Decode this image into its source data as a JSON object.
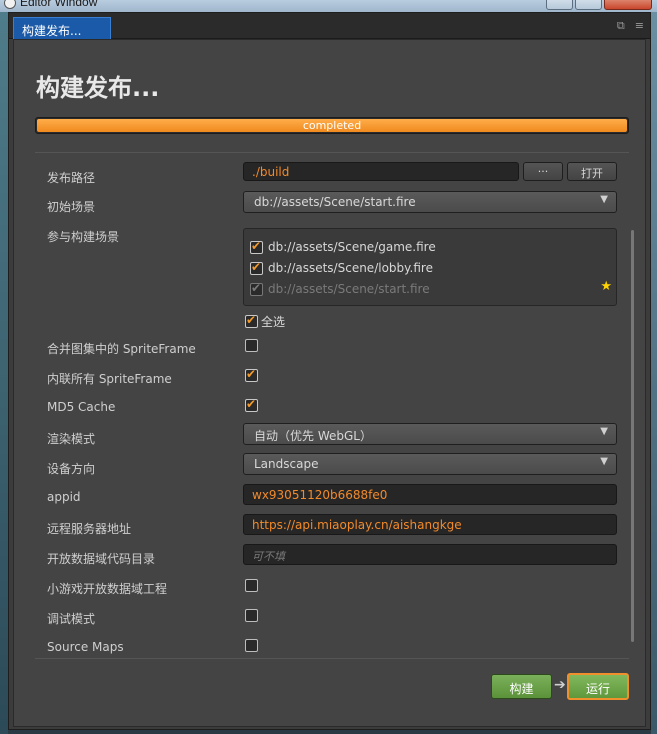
{
  "os": {
    "title": "Editor Window"
  },
  "tab": {
    "label": "构建发布..."
  },
  "page": {
    "title": "构建发布..."
  },
  "progress": {
    "label": "completed",
    "value": 1.0
  },
  "fields": {
    "build_path": {
      "label": "发布路径",
      "value": "./build",
      "browse_label": "···",
      "open_label": "打开"
    },
    "start_scene": {
      "label": "初始场景",
      "value": "db://assets/Scene/start.fire"
    },
    "scenes": {
      "label": "参与构建场景",
      "items": [
        {
          "label": "db://assets/Scene/game.fire",
          "checked": true,
          "disabled": false
        },
        {
          "label": "db://assets/Scene/lobby.fire",
          "checked": true,
          "disabled": false
        },
        {
          "label": "db://assets/Scene/start.fire",
          "checked": true,
          "disabled": true
        }
      ],
      "select_all_label": "全选"
    },
    "merge_spriteframe": {
      "label": "合并图集中的 SpriteFrame",
      "checked": false
    },
    "inline_spriteframe": {
      "label": "内联所有 SpriteFrame",
      "checked": true
    },
    "md5_cache": {
      "label": "MD5 Cache",
      "checked": true
    },
    "render_mode": {
      "label": "渲染模式",
      "value": "自动（优先 WebGL）"
    },
    "orientation": {
      "label": "设备方向",
      "value": "Landscape"
    },
    "appid": {
      "label": "appid",
      "value": "wx93051120b6688fe0"
    },
    "remote_server": {
      "label": "远程服务器地址",
      "value": "https://api.miaoplay.cn/aishangkge"
    },
    "open_data_dir": {
      "label": "开放数据域代码目录",
      "placeholder": "可不填"
    },
    "subgame_open_data": {
      "label": "小游戏开放数据域工程",
      "checked": false
    },
    "debug_mode": {
      "label": "调试模式",
      "checked": false
    },
    "source_maps": {
      "label": "Source Maps",
      "checked": false
    }
  },
  "actions": {
    "build_label": "构建",
    "run_label": "运行"
  },
  "colors": {
    "accent": "#f08a1e",
    "build_green": "#5b9239",
    "tab_blue": "#1b5aa8"
  }
}
